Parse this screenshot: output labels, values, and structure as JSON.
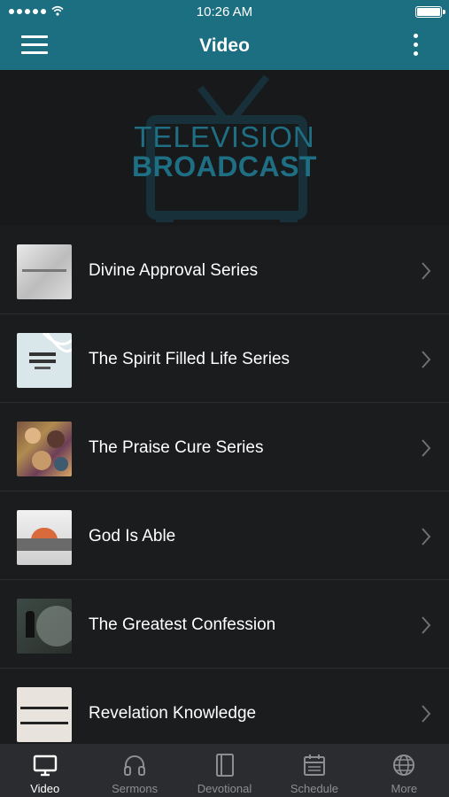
{
  "status_bar": {
    "time": "10:26 AM"
  },
  "header": {
    "title": "Video"
  },
  "banner": {
    "line1": "TELEVISION",
    "line2": "BROADCAST"
  },
  "list": {
    "items": [
      {
        "label": "Divine Approval Series",
        "thumb": "divine-approval-thumbnail"
      },
      {
        "label": "The Spirit Filled Life Series",
        "thumb": "spirit-filled-life-thumbnail"
      },
      {
        "label": "The Praise Cure Series",
        "thumb": "praise-cure-thumbnail"
      },
      {
        "label": "God Is Able",
        "thumb": "god-is-able-thumbnail"
      },
      {
        "label": "The Greatest Confession",
        "thumb": "greatest-confession-thumbnail"
      },
      {
        "label": "Revelation Knowledge",
        "thumb": "revelation-knowledge-thumbnail"
      }
    ]
  },
  "tabbar": {
    "tabs": [
      {
        "label": "Video",
        "icon": "monitor-icon",
        "active": true
      },
      {
        "label": "Sermons",
        "icon": "headphones-icon",
        "active": false
      },
      {
        "label": "Devotional",
        "icon": "book-icon",
        "active": false
      },
      {
        "label": "Schedule",
        "icon": "calendar-icon",
        "active": false
      },
      {
        "label": "More",
        "icon": "globe-icon",
        "active": false
      }
    ]
  },
  "colors": {
    "header_bg": "#1c6f80",
    "banner_text": "#1f6f84",
    "background": "#1b1c1e",
    "tabbar_bg": "#2b2c2f",
    "tab_inactive": "#8d8e91",
    "tab_active": "#ffffff"
  }
}
